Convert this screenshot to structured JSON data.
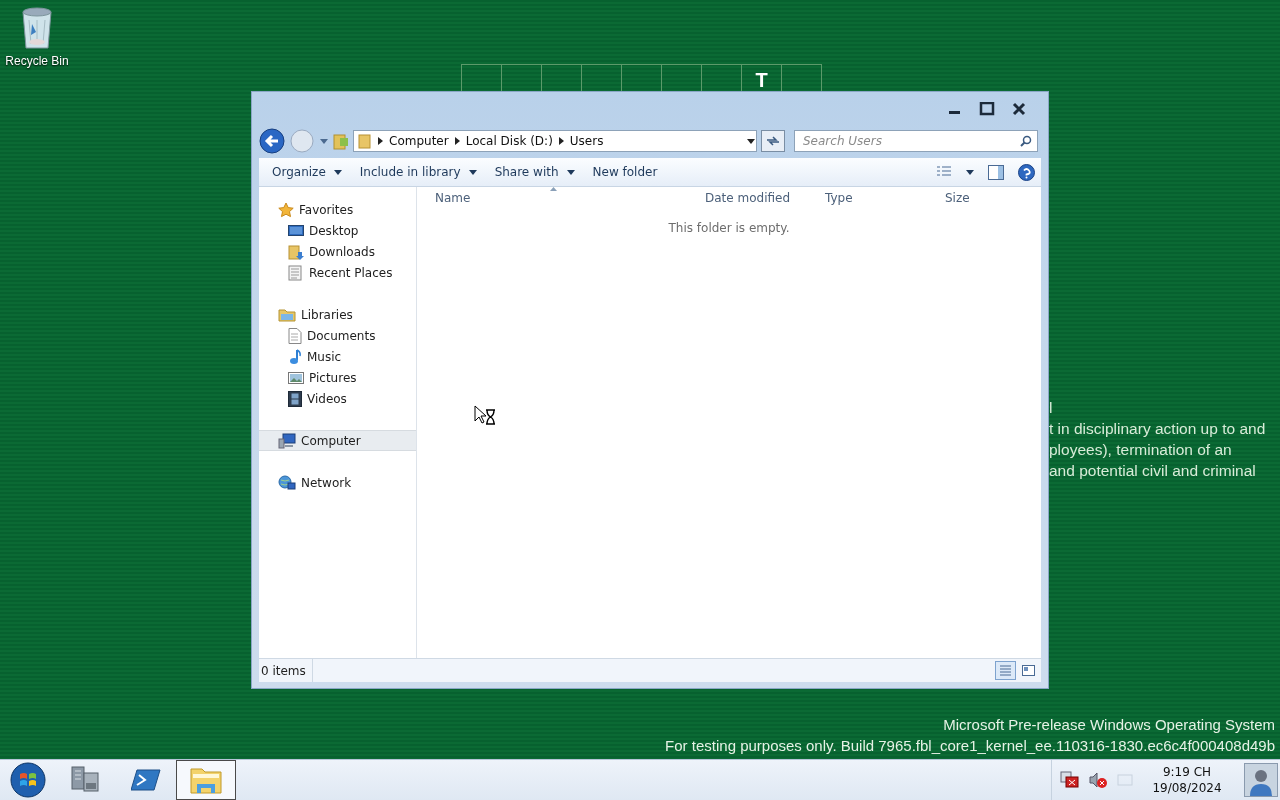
{
  "desktop": {
    "icons": [
      {
        "label": "Recycle Bin",
        "kind": "recycle-bin"
      }
    ],
    "top_strip": {
      "cells": [
        {
          "kind": "empty"
        },
        {
          "kind": "empty"
        },
        {
          "kind": "empty"
        },
        {
          "kind": "empty"
        },
        {
          "kind": "empty"
        },
        {
          "kind": "empty"
        },
        {
          "kind": "empty"
        },
        {
          "kind": "letter",
          "text": "T"
        },
        {
          "kind": "empty"
        }
      ]
    },
    "background_text": {
      "lines": [
        "l",
        "t in disciplinary action up to and",
        "ployees), termination of an",
        "and potential civil and criminal"
      ]
    },
    "build_notice": {
      "lines": [
        "Microsoft Pre-release Windows Operating System",
        "For testing purposes only. Build 7965.fbl_core1_kernel_ee.110316-1830.ec6c4f000408d49b"
      ]
    }
  },
  "window": {
    "address_bar": {
      "path": [
        "Computer",
        "Local Disk (D:)",
        "Users"
      ]
    },
    "search": {
      "placeholder": "Search Users"
    },
    "toolbar": {
      "buttons": [
        {
          "label": "Organize",
          "dropdown": true
        },
        {
          "label": "Include in library",
          "dropdown": true
        },
        {
          "label": "Share with",
          "dropdown": true
        },
        {
          "label": "New folder",
          "dropdown": false
        }
      ]
    },
    "navigation": {
      "groups": [
        {
          "label": "Favorites",
          "kind": "star",
          "selected": false,
          "children": [
            {
              "label": "Desktop",
              "kind": "desktop",
              "selected": false
            },
            {
              "label": "Downloads",
              "kind": "downloads",
              "selected": false
            },
            {
              "label": "Recent Places",
              "kind": "recent",
              "selected": false
            }
          ]
        },
        {
          "label": "Libraries",
          "kind": "libraries",
          "selected": false,
          "children": [
            {
              "label": "Documents",
              "kind": "document",
              "selected": false
            },
            {
              "label": "Music",
              "kind": "music",
              "selected": false
            },
            {
              "label": "Pictures",
              "kind": "pictures",
              "selected": false
            },
            {
              "label": "Videos",
              "kind": "videos",
              "selected": false
            }
          ]
        },
        {
          "label": "Computer",
          "kind": "computer",
          "selected": true
        },
        {
          "label": "Network",
          "kind": "network",
          "selected": false
        }
      ]
    },
    "file_list": {
      "columns": [
        {
          "label": "Name",
          "sorted": true
        },
        {
          "label": "Date modified",
          "sorted": false
        },
        {
          "label": "Type",
          "sorted": false
        },
        {
          "label": "Size",
          "sorted": false
        }
      ],
      "empty_message": "This folder is empty."
    },
    "status_bar": {
      "item_count": "0 items",
      "views": [
        {
          "kind": "details",
          "selected": true
        },
        {
          "kind": "tiles",
          "selected": false
        }
      ]
    }
  },
  "taskbar": {
    "buttons": [
      {
        "kind": "server-manager",
        "selected": false
      },
      {
        "kind": "powershell",
        "selected": false
      },
      {
        "kind": "explorer",
        "selected": true
      }
    ],
    "clock": {
      "time": "9:19 CH",
      "date": "19/08/2024"
    }
  }
}
